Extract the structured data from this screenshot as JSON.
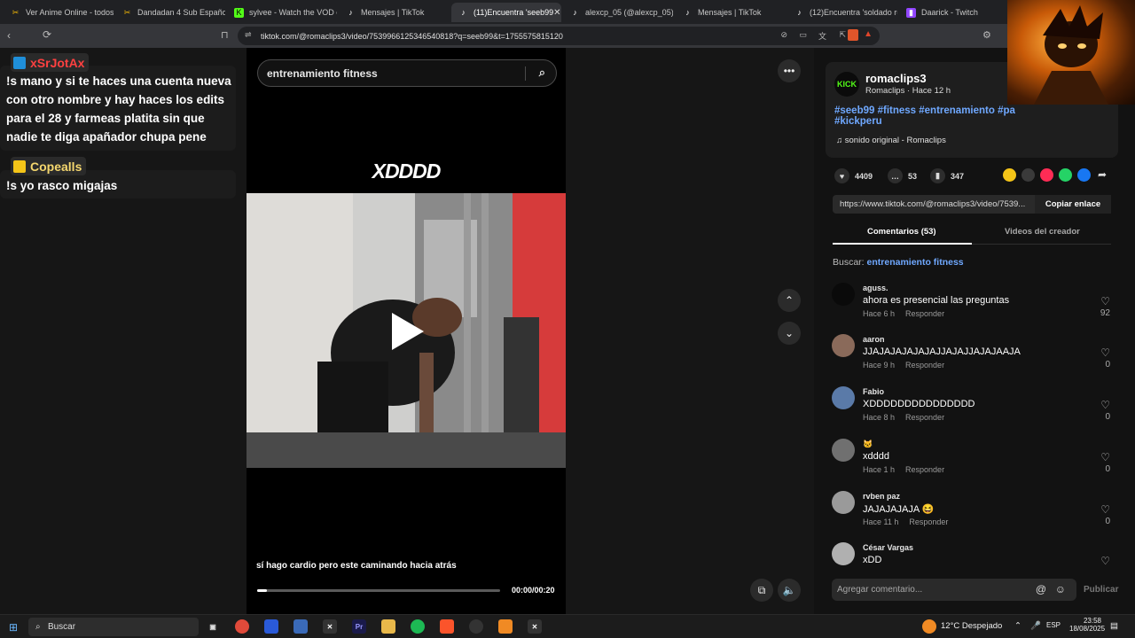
{
  "browser": {
    "tabs": [
      {
        "title": "Ver Anime Online - todos",
        "favicon_color": "#f2b705"
      },
      {
        "title": "Dandadan 4 Sub Español",
        "favicon_color": "#f2b705"
      },
      {
        "title": "sylvee - Watch the VOD o",
        "favicon_color": "#53fc18"
      },
      {
        "title": "Mensajes | TikTok",
        "favicon_color": "#111111"
      },
      {
        "title": "(11)Encuentra 'seeb99",
        "favicon_color": "#111111",
        "active": true
      },
      {
        "title": "alexcp_05 (@alexcp_05) |",
        "favicon_color": "#111111"
      },
      {
        "title": "Mensajes | TikTok",
        "favicon_color": "#111111"
      },
      {
        "title": "(12)Encuentra 'soldado ru",
        "favicon_color": "#111111"
      },
      {
        "title": "Daarick - Twitch",
        "favicon_color": "#9146ff"
      }
    ],
    "url": "tiktok.com/@romaclips3/video/7539966125346540818?q=seeb99&t=1755575815120"
  },
  "chat": {
    "messages": [
      {
        "user": "xSrJotAx",
        "user_color": "#ff4040",
        "text_lines": [
          "!s mano y si te haces una cuenta nueva",
          "con otro nombre y hay haces los edits",
          "para el 28 y farmeas platita sin que",
          "nadie te diga apañador chupa pene"
        ]
      },
      {
        "user": "Copealls",
        "user_color": "#f5d76e",
        "text_lines": [
          "!s yo rasco migajas"
        ]
      }
    ]
  },
  "video": {
    "search_value": "entrenamiento fitness",
    "overlay_text": "XDDDD",
    "caption": "sí hago cardio pero este caminando hacia atrás",
    "time": "00:00/00:20",
    "progress": 0.04
  },
  "post": {
    "author": "romaclips3",
    "author_sub": "Romaclips · Hace 12 h",
    "kick_label": "KICK",
    "hashtags_line1": "#seeb99 #fitness #entrenamiento #pa",
    "hashtags_line2": "#kickperu",
    "sound": "sonido original - Romaclips",
    "likes": "4409",
    "comments": "53",
    "saves": "347",
    "link": "https://www.tiktok.com/@romaclips3/video/7539...",
    "copy_label": "Copiar enlace",
    "tab_comments": "Comentarios (53)",
    "tab_creator": "Videos del creador",
    "search_prefix": "Buscar:",
    "search_term": "entrenamiento fitness",
    "add_comment_placeholder": "Agregar comentario...",
    "publish_label": "Publicar"
  },
  "comments": [
    {
      "name": "aguss.",
      "text": "ahora es presencial las preguntas",
      "time": "Hace 6 h",
      "likes": "92",
      "avatar_color": "#0a0a0a"
    },
    {
      "name": "aaron",
      "text": "JJAJAJAJAJAJAJJAJAJJAJAJAAJA",
      "time": "Hace 9 h",
      "likes": "0",
      "avatar_color": "#8a6a5a"
    },
    {
      "name": "Fabio",
      "text": "XDDDDDDDDDDDDDDD",
      "time": "Hace 8 h",
      "likes": "0",
      "avatar_color": "#5a7aa8"
    },
    {
      "name": "🐱",
      "text": "xdddd",
      "time": "Hace 1 h",
      "likes": "0",
      "avatar_color": "#707070"
    },
    {
      "name": "rvben paz",
      "text": "JAJAJAJAJA 😆",
      "time": "Hace 11 h",
      "likes": "0",
      "avatar_color": "#9a9a9a"
    },
    {
      "name": "César Vargas",
      "text": "xDD",
      "time": "",
      "likes": "",
      "avatar_color": "#b0b0b0"
    }
  ],
  "reply_label": "Responder",
  "taskbar": {
    "search_label": "Buscar",
    "weather": "12°C  Despejado",
    "lang": "ESP",
    "time": "23:58",
    "date": "18/08/2025"
  }
}
